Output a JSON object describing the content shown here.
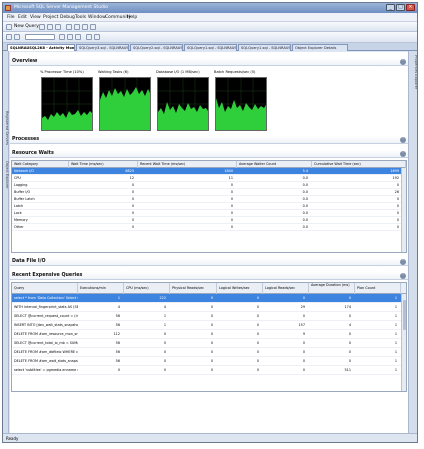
{
  "window": {
    "title": "Microsoft SQL Server Management Studio",
    "min": "_",
    "max": "□",
    "close": "×"
  },
  "menu": [
    "File",
    "Edit",
    "View",
    "Project",
    "Debug",
    "Tools",
    "Window",
    "Community",
    "Help"
  ],
  "toolbar": {
    "new_query": "New Query"
  },
  "tabs": [
    "SQLNRAUSQL2K8 - Activity Monitor",
    "SQLQuery3.sql - SQLNRAUS...",
    "SQLQuery2.sql - SQLNRAUS...",
    "SQLQuery1.sql - SQLNRAUS...",
    "SQLQuery1.sql - SQLNRAUS...",
    "Object Explorer Details"
  ],
  "left_sidebar": [
    "Registered Servers",
    "Object Explorer"
  ],
  "right_sidebar": "Properties Explorer",
  "overview": {
    "title": "Overview",
    "graphs": [
      {
        "label": "% Processor Time (10%)",
        "level": 0.35
      },
      {
        "label": "Waiting Tasks (6)",
        "level": 0.7
      },
      {
        "label": "Database I/O (1 MB/sec)",
        "level": 0.45
      },
      {
        "label": "Batch Requests/sec (5)",
        "level": 0.5
      }
    ]
  },
  "processes": {
    "title": "Processes"
  },
  "resource_waits": {
    "title": "Resource Waits",
    "columns": [
      "Wait Category",
      "Wait Time (ms/sec)",
      "Recent Wait Time (ms/sec)",
      "Average Waiter Count",
      "Cumulative Wait Time (sec)"
    ],
    "rows": [
      [
        "Network I/O",
        "6825",
        "1840",
        "5.4",
        "1699"
      ],
      [
        "CPU",
        "12",
        "11",
        "0.0",
        "192"
      ],
      [
        "Logging",
        "0",
        "0",
        "0.0",
        "0"
      ],
      [
        "Buffer I/O",
        "0",
        "0",
        "0.0",
        "26"
      ],
      [
        "Buffer Latch",
        "0",
        "0",
        "0.0",
        "0"
      ],
      [
        "Latch",
        "0",
        "0",
        "0.0",
        "0"
      ],
      [
        "Lock",
        "0",
        "0",
        "0.0",
        "0"
      ],
      [
        "Memory",
        "0",
        "0",
        "0.0",
        "0"
      ],
      [
        "Other",
        "0",
        "0",
        "0.0",
        "0"
      ]
    ]
  },
  "data_file_io": {
    "title": "Data File I/O"
  },
  "expensive_queries": {
    "title": "Recent Expensive Queries",
    "columns": [
      "Query",
      "Executions/min",
      "CPU (ms/sec)",
      "Physical Reads/sec",
      "Logical Writes/sec",
      "Logical Reads/sec",
      "Average Duration (ms)",
      "Plan Count"
    ],
    "rows": [
      [
        "select * from 'Data Collection' Select Collection...",
        "1",
        "222",
        "9",
        "0",
        "0",
        "0",
        "1"
      ],
      [
        "WITH interval_fingerprint_stats AS (SELECT ...",
        "4",
        "4",
        "0",
        "0",
        "29",
        "174",
        "1"
      ],
      [
        "SELECT @current_request_count = (int_value...",
        "56",
        "1",
        "0",
        "0",
        "0",
        "0",
        "1"
      ],
      [
        "INSERT INTO [dev_wait_stats_snapshots SEL...",
        "56",
        "1",
        "0",
        "0",
        "157",
        "4",
        "1"
      ],
      [
        "DELETE FROM #am_resource_mon_snap WH...",
        "112",
        "0",
        "0",
        "0",
        "9",
        "0",
        "1"
      ],
      [
        "SELECT @current_total_io_mb = SUM(num_of...",
        "56",
        "0",
        "0",
        "0",
        "0",
        "0",
        "1"
      ],
      [
        "DELETE FROM #am_dbfileio WHERE collecti...",
        "56",
        "0",
        "0",
        "0",
        "0",
        "0",
        "1"
      ],
      [
        "DELETE FROM #am_wait_stats_snapshots W...",
        "56",
        "0",
        "0",
        "0",
        "0",
        "0",
        "1"
      ],
      [
        "select 'subtitles' = pgmedia.enname collate d...",
        "0",
        "0",
        "0",
        "0",
        "0",
        "511",
        "1"
      ]
    ]
  },
  "status": "Ready"
}
